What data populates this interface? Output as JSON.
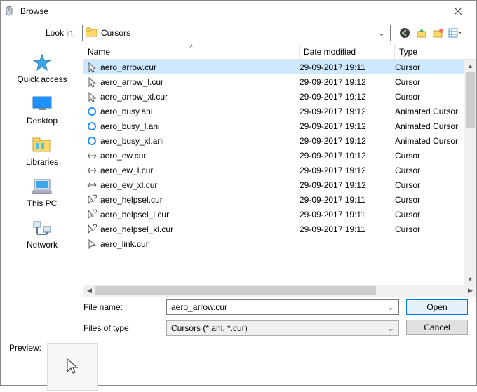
{
  "title": "Browse",
  "lookin_label": "Look in:",
  "lookin_value": "Cursors",
  "places": [
    {
      "label": "Quick access"
    },
    {
      "label": "Desktop"
    },
    {
      "label": "Libraries"
    },
    {
      "label": "This PC"
    },
    {
      "label": "Network"
    }
  ],
  "columns": {
    "name": "Name",
    "date": "Date modified",
    "type": "Type"
  },
  "files": [
    {
      "icon": "arrow",
      "name": "aero_arrow.cur",
      "date": "29-09-2017 19:11",
      "type": "Cursor",
      "selected": true
    },
    {
      "icon": "arrow",
      "name": "aero_arrow_l.cur",
      "date": "29-09-2017 19:12",
      "type": "Cursor"
    },
    {
      "icon": "arrow",
      "name": "aero_arrow_xl.cur",
      "date": "29-09-2017 19:12",
      "type": "Cursor"
    },
    {
      "icon": "busy",
      "name": "aero_busy.ani",
      "date": "29-09-2017 19:12",
      "type": "Animated Cursor"
    },
    {
      "icon": "busy",
      "name": "aero_busy_l.ani",
      "date": "29-09-2017 19:12",
      "type": "Animated Cursor"
    },
    {
      "icon": "busy",
      "name": "aero_busy_xl.ani",
      "date": "29-09-2017 19:12",
      "type": "Animated Cursor"
    },
    {
      "icon": "ew",
      "name": "aero_ew.cur",
      "date": "29-09-2017 19:12",
      "type": "Cursor"
    },
    {
      "icon": "ew",
      "name": "aero_ew_l.cur",
      "date": "29-09-2017 19:12",
      "type": "Cursor"
    },
    {
      "icon": "ew",
      "name": "aero_ew_xl.cur",
      "date": "29-09-2017 19:12",
      "type": "Cursor"
    },
    {
      "icon": "help",
      "name": "aero_helpsel.cur",
      "date": "29-09-2017 19:11",
      "type": "Cursor"
    },
    {
      "icon": "help",
      "name": "aero_helpsel_l.cur",
      "date": "29-09-2017 19:11",
      "type": "Cursor"
    },
    {
      "icon": "help",
      "name": "aero_helpsel_xl.cur",
      "date": "29-09-2017 19:11",
      "type": "Cursor"
    },
    {
      "icon": "link",
      "name": "aero_link.cur",
      "date": "",
      "type": ""
    }
  ],
  "filename_label": "File name:",
  "filename_value": "aero_arrow.cur",
  "filetype_label": "Files of type:",
  "filetype_value": "Cursors (*.ani, *.cur)",
  "open_label": "Open",
  "cancel_label": "Cancel",
  "preview_label": "Preview:"
}
